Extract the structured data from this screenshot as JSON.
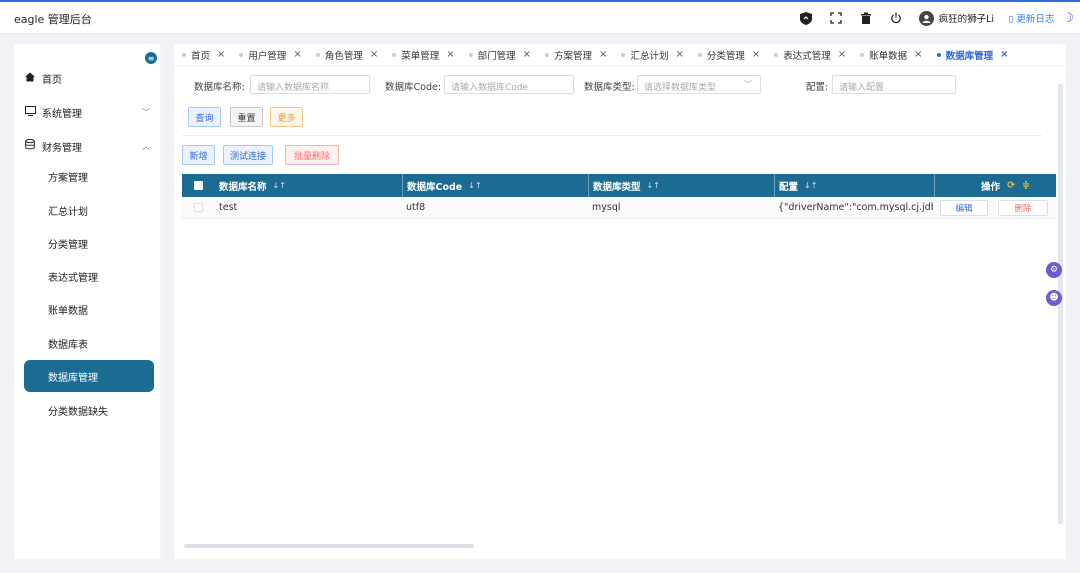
{
  "header": {
    "title": "eagle 管理后台",
    "username": "疯狂的狮子Li",
    "changelog": "更新日志",
    "icons": [
      "shield-icon",
      "fullscreen-icon",
      "trash-icon",
      "power-icon",
      "user-avatar-icon",
      "theme-moon-icon"
    ]
  },
  "sidebar": {
    "items": [
      {
        "label": "首页",
        "icon": "home-icon"
      },
      {
        "label": "系统管理",
        "icon": "monitor-icon"
      },
      {
        "label": "财务管理",
        "icon": "database-icon"
      },
      {
        "label": "方案管理"
      },
      {
        "label": "汇总计划"
      },
      {
        "label": "分类管理"
      },
      {
        "label": "表达式管理"
      },
      {
        "label": "账单数据"
      },
      {
        "label": "数据库表"
      },
      {
        "label": "数据库管理"
      },
      {
        "label": "分类数据缺失"
      }
    ]
  },
  "tabs": [
    {
      "label": "首页"
    },
    {
      "label": "用户管理"
    },
    {
      "label": "角色管理"
    },
    {
      "label": "菜单管理"
    },
    {
      "label": "部门管理"
    },
    {
      "label": "方案管理"
    },
    {
      "label": "汇总计划"
    },
    {
      "label": "分类管理"
    },
    {
      "label": "表达式管理"
    },
    {
      "label": "账单数据"
    },
    {
      "label": "数据库管理"
    }
  ],
  "filters": {
    "name_label": "数据库名称:",
    "name_placeholder": "请输入数据库名称",
    "code_label": "数据库Code:",
    "code_placeholder": "请输入数据库Code",
    "type_label": "数据库类型:",
    "type_placeholder": "请选择数据库类型",
    "config_label": "配置:",
    "config_placeholder": "请输入配置"
  },
  "actions": {
    "query": "查询",
    "reset": "重置",
    "more": "更多",
    "add": "新增",
    "test_connection": "测试连接",
    "batch_delete": "批量删除"
  },
  "table": {
    "columns": [
      "数据库名称",
      "数据库Code",
      "数据库类型",
      "配置",
      "操作"
    ],
    "sort_glyph": "↓↑",
    "rows": [
      {
        "name": "test",
        "code": "utf8",
        "type": "mysql",
        "config": "{\"driverName\":\"com.mysql.cj.jdbc.Dri",
        "edit": "编辑",
        "delete": "删除"
      }
    ]
  }
}
